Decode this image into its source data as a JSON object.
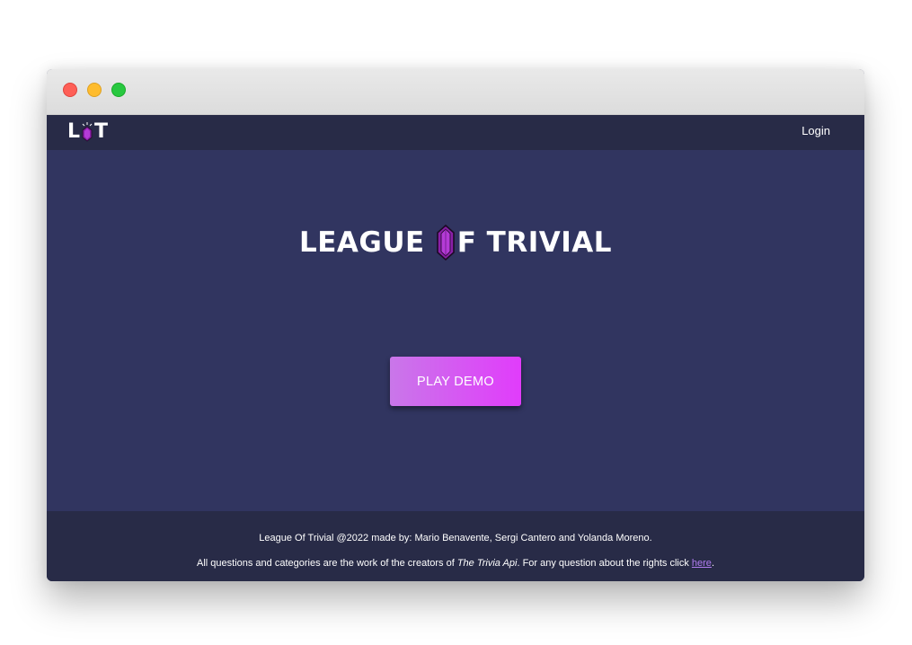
{
  "window": {
    "controls": [
      "close",
      "minimize",
      "maximize"
    ]
  },
  "navbar": {
    "logo": {
      "left": "L",
      "right": "T",
      "icon": "gem-icon"
    },
    "login_label": "Login"
  },
  "hero": {
    "title_part1": "LEAGUE",
    "title_part2": "F TRIVIAL",
    "title_icon": "gem-icon",
    "play_button_label": "PLAY DEMO"
  },
  "footer": {
    "line1": "League Of Trivial @2022 made by: Mario Benavente, Sergi Cantero and Yolanda Moreno.",
    "line2_prefix": "All questions and categories are the work of the creators of ",
    "line2_em": "The Trivia Api",
    "line2_middle": ". For any question about the rights click ",
    "line2_link": "here",
    "line2_suffix": "."
  },
  "colors": {
    "hero_bg": "#313560",
    "nav_bg": "#282b47",
    "button_gradient_start": "#c977e9",
    "button_gradient_end": "#e13cfb",
    "link": "#b07cf0",
    "gem": "#8b1fa8"
  }
}
